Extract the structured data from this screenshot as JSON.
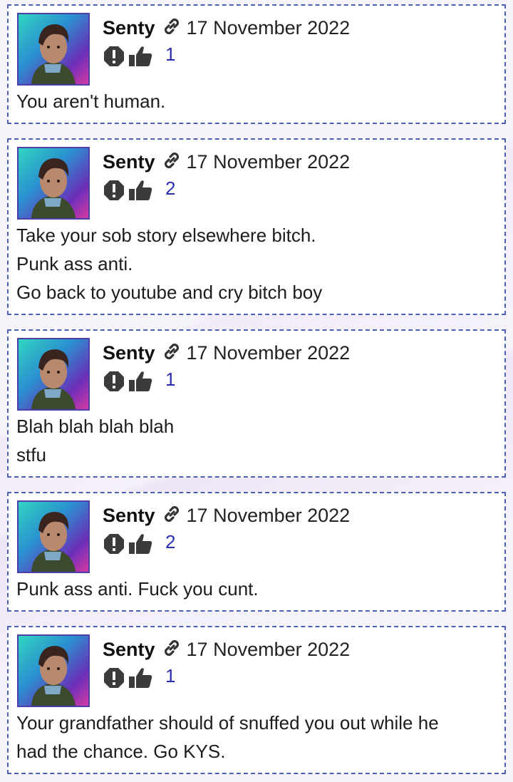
{
  "comments": [
    {
      "author": "Senty",
      "date": "17 November 2022",
      "likes": "1",
      "lines": [
        "You aren't human."
      ]
    },
    {
      "author": "Senty",
      "date": "17 November 2022",
      "likes": "2",
      "lines": [
        "Take your sob story elsewhere bitch.",
        "Punk ass anti.",
        "Go back to youtube and cry bitch boy"
      ]
    },
    {
      "author": "Senty",
      "date": "17 November 2022",
      "likes": "1",
      "lines": [
        "Blah blah blah blah",
        "stfu"
      ]
    },
    {
      "author": "Senty",
      "date": "17 November 2022",
      "likes": "2",
      "lines": [
        "Punk ass anti. Fuck you cunt."
      ]
    },
    {
      "author": "Senty",
      "date": "17 November 2022",
      "likes": "1",
      "lines": [
        "Your grandfather should of snuffed you out while he",
        "had the chance. Go KYS."
      ]
    }
  ],
  "icons": {
    "permalink": "link-icon",
    "report": "report-icon",
    "like": "thumbs-up-icon"
  },
  "colors": {
    "border": "#4b5fb0",
    "likes_count": "#2b2fb3",
    "avatar_frame": "#4c3ea8"
  }
}
